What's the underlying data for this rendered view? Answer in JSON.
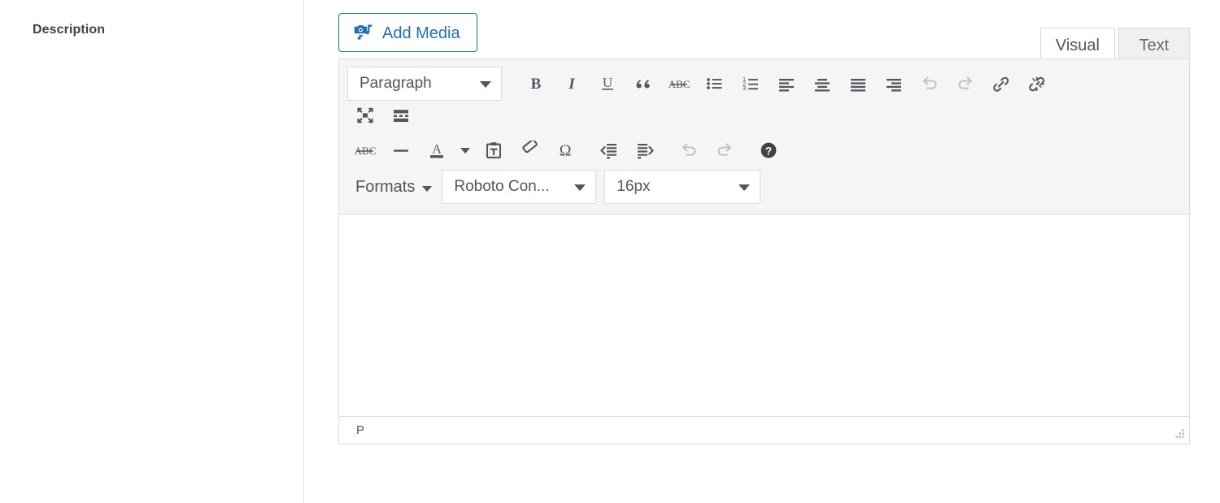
{
  "form": {
    "label": "Description"
  },
  "media": {
    "button_label": "Add Media",
    "icon": "add-media-icon"
  },
  "tabs": [
    {
      "label": "Visual",
      "active": true
    },
    {
      "label": "Text",
      "active": false
    }
  ],
  "toolbar": {
    "row1": {
      "block_format": {
        "value": "Paragraph",
        "icon": "chevron-down-icon"
      },
      "buttons": [
        {
          "name": "bold-button",
          "label": "B",
          "disabled": false
        },
        {
          "name": "italic-button",
          "label": "I",
          "disabled": false
        },
        {
          "name": "underline-button",
          "label": "U",
          "disabled": false
        },
        {
          "name": "blockquote-button",
          "label": "“",
          "disabled": false
        },
        {
          "name": "strikethrough-button",
          "label": "ABC",
          "disabled": false
        },
        {
          "name": "bulleted-list-button",
          "label": "",
          "disabled": false
        },
        {
          "name": "numbered-list-button",
          "label": "",
          "disabled": false
        },
        {
          "name": "align-left-button",
          "label": "",
          "disabled": false
        },
        {
          "name": "align-center-button",
          "label": "",
          "disabled": false
        },
        {
          "name": "align-justify-button",
          "label": "",
          "disabled": false
        },
        {
          "name": "align-right-button",
          "label": "",
          "disabled": false
        },
        {
          "name": "undo-button",
          "label": "",
          "disabled": true
        },
        {
          "name": "redo-button",
          "label": "",
          "disabled": true
        },
        {
          "name": "insert-link-button",
          "label": "",
          "disabled": false
        },
        {
          "name": "remove-link-button",
          "label": "",
          "disabled": false
        }
      ]
    },
    "row2": {
      "buttons": [
        {
          "name": "fullscreen-button",
          "label": "",
          "disabled": false
        },
        {
          "name": "read-more-button",
          "label": "",
          "disabled": false
        }
      ]
    },
    "row3": {
      "buttons": [
        {
          "name": "strikethrough-button",
          "label": "ABC",
          "disabled": false
        },
        {
          "name": "horizontal-rule-button",
          "label": "",
          "disabled": false
        },
        {
          "name": "text-color-button",
          "label": "A",
          "disabled": false
        },
        {
          "name": "text-color-dropdown",
          "label": "",
          "disabled": false
        },
        {
          "name": "paste-as-text-button",
          "label": "",
          "disabled": false
        },
        {
          "name": "clear-formatting-button",
          "label": "",
          "disabled": false
        },
        {
          "name": "special-character-button",
          "label": "Ω",
          "disabled": false
        },
        {
          "name": "outdent-button",
          "label": "",
          "disabled": false
        },
        {
          "name": "indent-button",
          "label": "",
          "disabled": false
        },
        {
          "name": "undo-button",
          "label": "",
          "disabled": true
        },
        {
          "name": "redo-button",
          "label": "",
          "disabled": true
        },
        {
          "name": "keyboard-shortcuts-button",
          "label": "?",
          "disabled": false
        }
      ]
    },
    "row4": {
      "formats_menu": {
        "label": "Formats",
        "icon": "chevron-down-icon"
      },
      "font_family": {
        "value": "Roboto Con...",
        "icon": "chevron-down-icon"
      },
      "font_size": {
        "value": "16px",
        "icon": "chevron-down-icon"
      }
    }
  },
  "editor": {
    "body_text": "",
    "statusbar_path": "P",
    "resize_handle": "resize-grip-icon"
  },
  "colors": {
    "accent": "#2271b1",
    "icon": "#50575e",
    "icon_disabled": "#c3c4c7",
    "toolbar_bg": "#f5f5f5",
    "border": "#dcdcde",
    "text": "#3c434a"
  }
}
